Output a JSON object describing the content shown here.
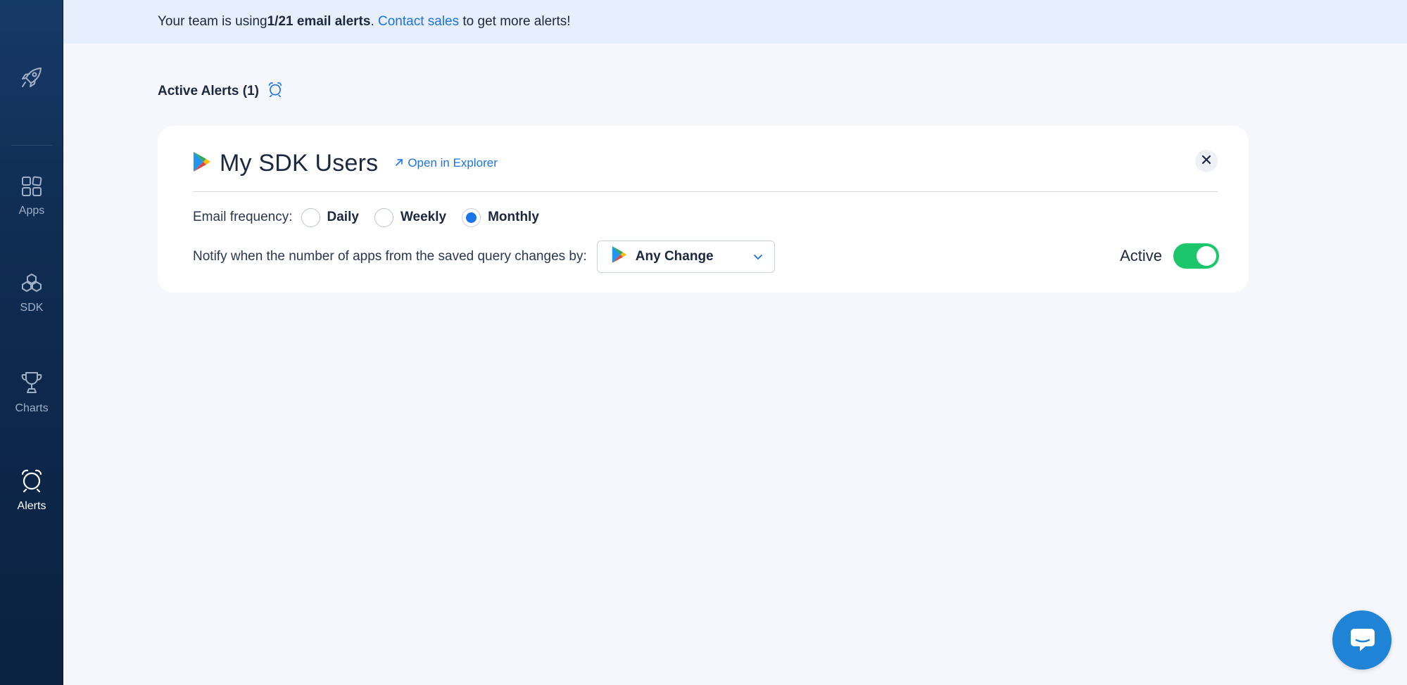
{
  "sidebar": {
    "items": [
      {
        "label": "Apps",
        "icon": "grid-icon"
      },
      {
        "label": "SDK",
        "icon": "cubes-icon"
      },
      {
        "label": "Charts",
        "icon": "trophy-icon"
      },
      {
        "label": "Alerts",
        "icon": "alarm-clock-icon",
        "active": true
      }
    ]
  },
  "banner": {
    "prefix": "Your team is using ",
    "usage": "1/21 email alerts",
    "period": ".",
    "space": " ",
    "link": "Contact sales",
    "suffix": " to get more alerts!"
  },
  "section": {
    "title": "Active Alerts (1)"
  },
  "alert": {
    "title": "My SDK Users",
    "open_link": "Open in Explorer",
    "frequency_label": "Email frequency:",
    "frequency_options": [
      "Daily",
      "Weekly",
      "Monthly"
    ],
    "frequency_selected": "Monthly",
    "notify_label": "Notify when the number of apps from the saved query changes by:",
    "change_select": "Any Change",
    "active_label": "Active",
    "active": true
  },
  "colors": {
    "accent": "#1a73e8",
    "toggle_on": "#1bc76a",
    "sidebar_bg": "#0f2c52",
    "banner_bg": "#e7eefd"
  }
}
